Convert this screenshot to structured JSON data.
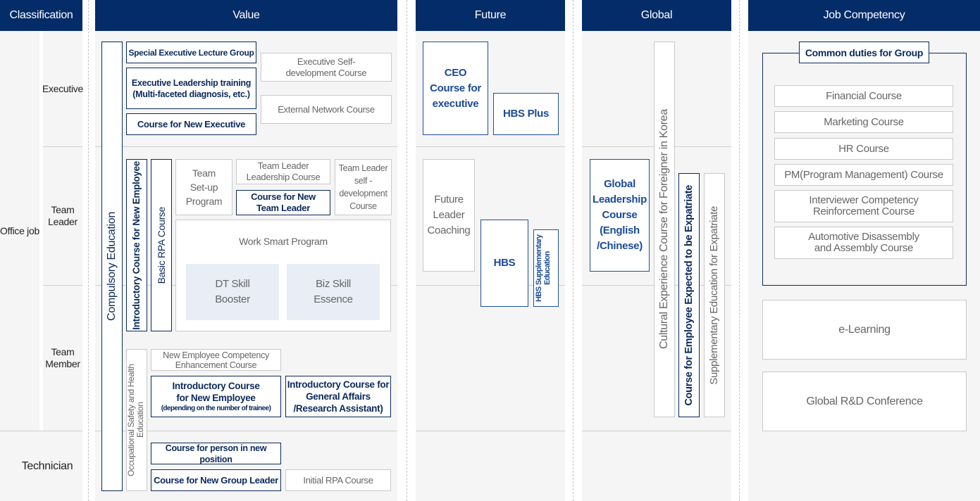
{
  "headers": {
    "classification": "Classification",
    "value": "Value",
    "future": "Future",
    "global": "Global",
    "job_competency": "Job Competency"
  },
  "classification": {
    "office_job": "Office job",
    "executive": "Executive",
    "team_leader": "Team Leader",
    "team_member": "Team Member",
    "technician": "Technician"
  },
  "value": {
    "compulsory_education": "Compulsory Education",
    "introductory_course_new_employee_vertical": "Introductory Course for New Employee",
    "basic_rpa_course": "Basic RPA Course",
    "occupational_safety": "Occupational Safety and Health Education",
    "special_executive_lecture": "Special Executive Lecture Group",
    "executive_leadership_training": "Executive Leadership training (Multi-faceted diagnosis, etc.)",
    "course_new_executive": "Course for New Executive",
    "executive_self_development": "Executive Self-development Course",
    "external_network_course": "External Network Course",
    "team_setup_program": "Team Set-up Program",
    "team_leader_leadership": "Team Leader Leadership Course",
    "course_new_team_leader": "Course for New Team Leader",
    "team_leader_self_development": "Team Leader self -development Course",
    "work_smart_program": "Work Smart Program",
    "dt_skill_booster": "DT Skill Booster",
    "biz_skill_essence": "Biz Skill Essence",
    "new_employee_competency": "New Employee Competency Enhancement Course",
    "introductory_new_employee_title": "Introductory Course for New Employee",
    "introductory_new_employee_note": "(depending on the number of trainee)",
    "introductory_general_affairs": "Introductory Course for General Affairs /Research Assistant)",
    "course_person_new_position": "Course for person in new position",
    "course_new_group_leader": "Course for New Group Leader",
    "initial_rpa_course": "Initial RPA Course"
  },
  "future": {
    "ceo_course": "CEO Course for executive",
    "hbs_plus": "HBS Plus",
    "future_leader_coaching": "Future Leader Coaching",
    "hbs": "HBS",
    "hbs_supplementary": "HBS Supplementary Education"
  },
  "global": {
    "global_leadership_course": "Global Leadership Course (English /Chinese)",
    "cultural_experience": "Cultural Experience Course for Foreigner in Korea",
    "course_expected_expatriate": "Course for Employee Expected to be Expatriate",
    "supplementary_expatriate": "Supplementary Education for Expatriate"
  },
  "job_competency": {
    "common_duties_title": "Common duties for Group",
    "courses": [
      "Financial Course",
      "Marketing Course",
      "HR Course",
      "PM(Program Management) Course",
      "Interviewer Competency Reinforcement Course",
      "Automotive Disassembly and Assembly Course"
    ],
    "e_learning": "e-Learning",
    "global_rnd_conference": "Global R&D Conference"
  },
  "colors": {
    "header_bg": "#042c68",
    "navy_border": "#0b2a5c",
    "blue_border": "#1d4f9a",
    "gray_border": "#c9c9c9",
    "panel_bg": "#f5f5f5",
    "shade_bg": "#e8edf6"
  }
}
